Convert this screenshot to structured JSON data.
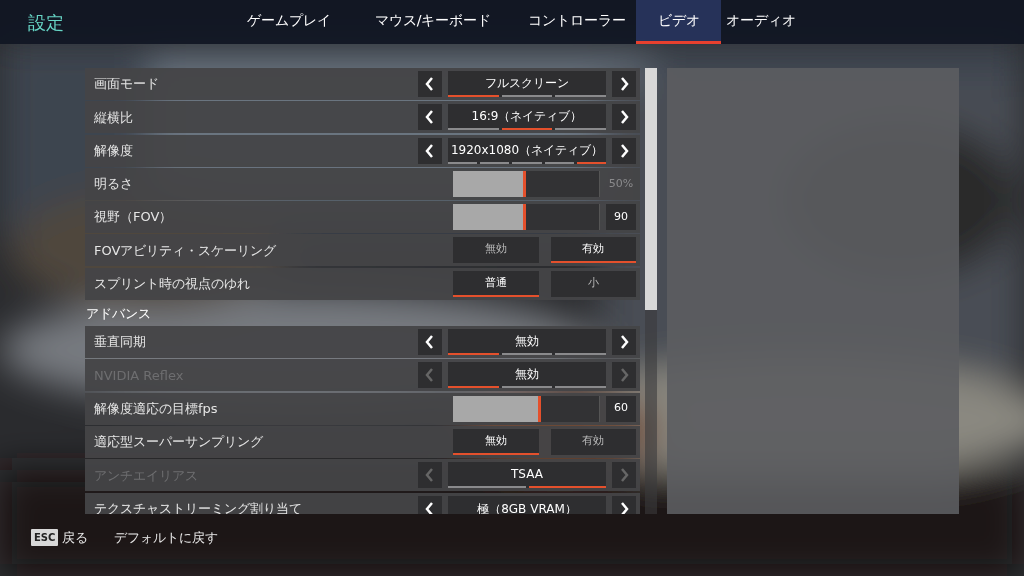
{
  "header": {
    "title": "設定",
    "tabs": [
      {
        "label": "ゲームプレイ",
        "selected": false
      },
      {
        "label": "マウス/キーボード",
        "selected": false
      },
      {
        "label": "コントローラー",
        "selected": false
      },
      {
        "label": "ビデオ",
        "selected": true
      },
      {
        "label": "オーディオ",
        "selected": false
      }
    ]
  },
  "settings": [
    {
      "kind": "carousel",
      "label": "画面モード",
      "value": "フルスクリーン",
      "disabled": false,
      "steps": [
        {
          "selected": true
        },
        {
          "selected": false
        },
        {
          "selected": false
        }
      ]
    },
    {
      "kind": "carousel",
      "label": "縦横比",
      "value": "16:9（ネイティブ）",
      "disabled": false,
      "steps": [
        {
          "selected": false
        },
        {
          "selected": true
        },
        {
          "selected": false
        }
      ]
    },
    {
      "kind": "carousel",
      "label": "解像度",
      "value": "1920x1080（ネイティブ）",
      "disabled": false,
      "steps": [
        {
          "selected": false
        },
        {
          "selected": false
        },
        {
          "selected": false
        },
        {
          "selected": false
        },
        {
          "selected": true
        }
      ]
    },
    {
      "kind": "slider",
      "label": "明るさ",
      "level": 0.5,
      "value": "50%",
      "boxed": false
    },
    {
      "kind": "slider",
      "label": "視野（FOV）",
      "level": 0.5,
      "value": "90",
      "boxed": true
    },
    {
      "kind": "toggle",
      "label": "FOVアビリティ・スケーリング",
      "options": [
        {
          "label": "無効",
          "selected": false
        },
        {
          "label": "有効",
          "selected": true
        }
      ]
    },
    {
      "kind": "toggle",
      "label": "スプリント時の視点のゆれ",
      "options": [
        {
          "label": "普通",
          "selected": true
        },
        {
          "label": "小",
          "selected": false
        }
      ]
    },
    {
      "kind": "heading",
      "label": "アドバンス"
    },
    {
      "kind": "carousel",
      "label": "垂直同期",
      "value": "無効",
      "disabled": false,
      "steps": [
        {
          "selected": true
        },
        {
          "selected": false
        },
        {
          "selected": false
        }
      ]
    },
    {
      "kind": "carousel",
      "label": "NVIDIA Reflex",
      "value": "無効",
      "disabled": true,
      "steps": [
        {
          "selected": true
        },
        {
          "selected": false
        },
        {
          "selected": false
        }
      ]
    },
    {
      "kind": "slider",
      "label": "解像度適応の目標fps",
      "level": 0.6,
      "value": "60",
      "boxed": true
    },
    {
      "kind": "toggle",
      "label": "適応型スーパーサンプリング",
      "options": [
        {
          "label": "無効",
          "selected": true
        },
        {
          "label": "有効",
          "selected": false
        }
      ]
    },
    {
      "kind": "carousel",
      "label": "アンチエイリアス",
      "value": "TSAA",
      "disabled": true,
      "steps": [
        {
          "selected": false
        },
        {
          "selected": true
        }
      ]
    },
    {
      "kind": "carousel",
      "label": "テクスチャストリーミング割り当て",
      "value": "極（8GB VRAM）",
      "disabled": false
    }
  ],
  "footer": {
    "key": "ESC",
    "back": "戻る",
    "reset": "デフォルトに戻す"
  }
}
